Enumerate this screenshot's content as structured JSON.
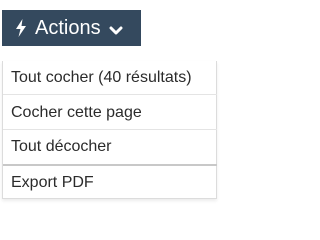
{
  "actions": {
    "label": "Actions",
    "icon": "bolt-icon",
    "chevron_icon": "chevron-down-icon",
    "color": "#34495e"
  },
  "menu": {
    "items": [
      {
        "label": "Tout cocher (40 résultats)"
      },
      {
        "label": "Cocher cette page"
      },
      {
        "label": "Tout décocher"
      },
      {
        "label": "Export PDF"
      }
    ]
  }
}
